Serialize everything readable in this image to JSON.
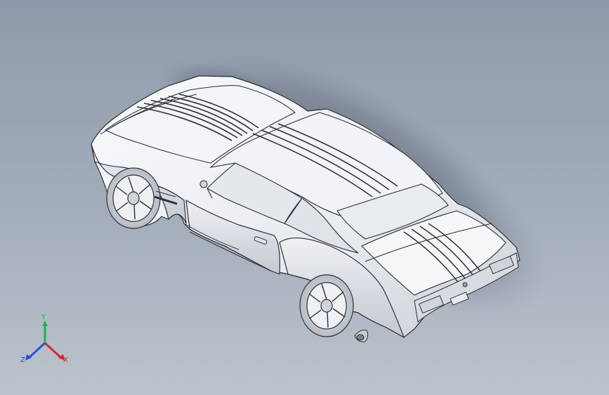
{
  "viewport": {
    "model": "car-assembly",
    "background_top": "#8e9aab",
    "background_bottom": "#bcc3cc"
  },
  "triad": {
    "x_label": "X",
    "y_label": "Y",
    "z_label": "Z",
    "x_color": "#d7262b",
    "y_color": "#22b14c",
    "z_color": "#2b4fd6"
  }
}
